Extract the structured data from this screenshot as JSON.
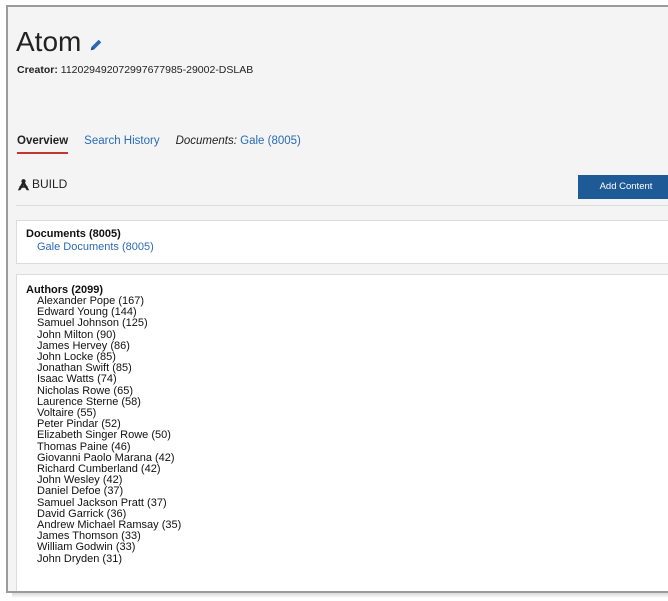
{
  "header": {
    "title": "Atom",
    "creator_label": "Creator:",
    "creator_value": "112029492072997677985-29002-DSLAB"
  },
  "tabs": {
    "overview": "Overview",
    "search_history": "Search History",
    "documents_prefix": "Documents:",
    "documents_link": "Gale (8005)"
  },
  "build": {
    "label": "BUILD",
    "add_content_label": "Add Content"
  },
  "documents_panel": {
    "heading": "Documents (8005)",
    "link": "Gale Documents (8005)"
  },
  "authors_panel": {
    "heading": "Authors (2099)",
    "items": [
      "Alexander Pope (167)",
      "Edward Young (144)",
      "Samuel Johnson (125)",
      "John Milton (90)",
      "James Hervey (86)",
      "John Locke (85)",
      "Jonathan Swift (85)",
      "Isaac Watts (74)",
      "Nicholas Rowe (65)",
      "Laurence Sterne (58)",
      "Voltaire (55)",
      "Peter Pindar (52)",
      "Elizabeth Singer Rowe (50)",
      "Thomas Paine (46)",
      "Giovanni Paolo Marana (42)",
      "Richard Cumberland (42)",
      "John Wesley (42)",
      "Daniel Defoe (37)",
      "Samuel Jackson Pratt (37)",
      "David Garrick (36)",
      "Andrew Michael Ramsay (35)",
      "James Thomson (33)",
      "William Godwin (33)",
      "John Dryden (31)"
    ]
  },
  "icons": {
    "edit": "pencil-icon",
    "build": "build-icon"
  },
  "colors": {
    "link": "#2a6bb4",
    "primary_button": "#1e5a96",
    "active_tab_underline": "#c0392b"
  }
}
